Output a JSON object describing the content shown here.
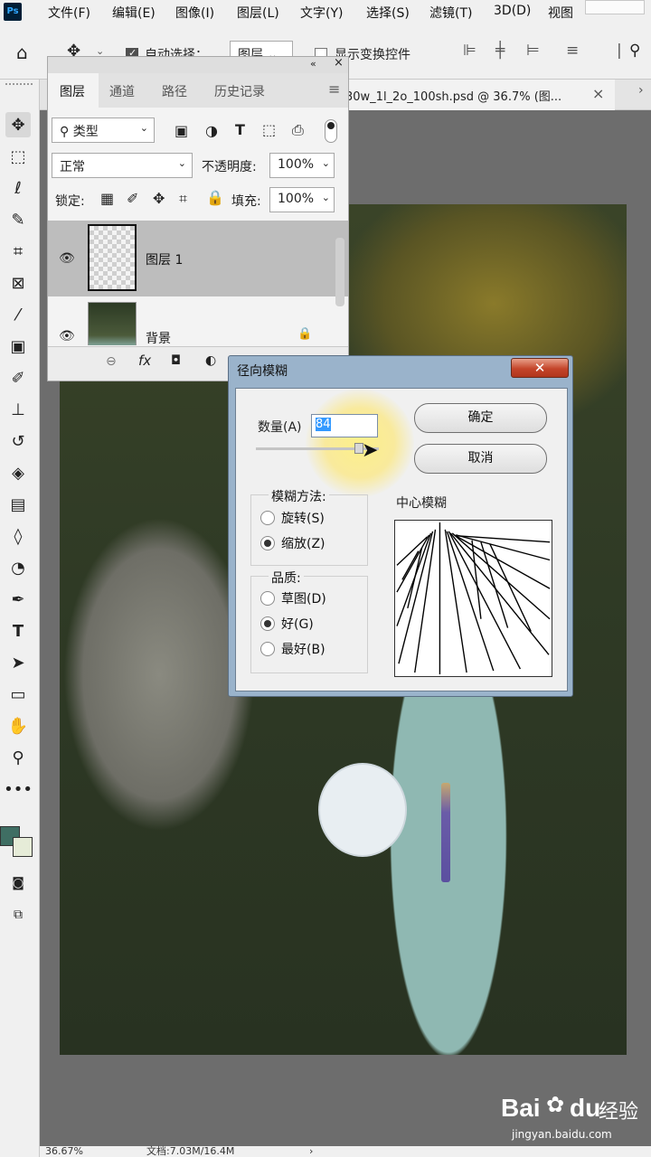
{
  "app": {
    "logo": "Ps"
  },
  "menu": [
    "文件(F)",
    "编辑(E)",
    "图像(I)",
    "图层(L)",
    "文字(Y)",
    "选择(S)",
    "滤镜(T)",
    "3D(D)",
    "视图"
  ],
  "options": {
    "auto_select_label": "自动选择：",
    "auto_select_checked": true,
    "auto_select_target": "图层",
    "show_transform_label": "显示变换控件",
    "show_transform_checked": false
  },
  "document": {
    "tab_title": "30w_1l_2o_100sh.psd @ 36.7% (图...",
    "zoom": "36.67%",
    "doc_size": "文档:7.03M/16.4M"
  },
  "layers_panel": {
    "tabs": [
      "图层",
      "通道",
      "路径",
      "历史记录"
    ],
    "active_tab": "图层",
    "filter_label": "类型",
    "blend_mode": "正常",
    "opacity_label": "不透明度:",
    "opacity": "100%",
    "lock_label": "锁定:",
    "fill_label": "填充:",
    "fill": "100%",
    "layers": [
      {
        "name": "图层 1",
        "visible": true,
        "selected": true
      },
      {
        "name": "背景",
        "visible": true,
        "selected": false,
        "locked": true
      }
    ]
  },
  "dialog": {
    "title": "径向模糊",
    "amount_label": "数量(A)",
    "amount_value": "84",
    "ok": "确定",
    "cancel": "取消",
    "method_label": "模糊方法:",
    "method_options": [
      "旋转(S)",
      "缩放(Z)"
    ],
    "method_selected": "缩放(Z)",
    "quality_label": "品质:",
    "quality_options": [
      "草图(D)",
      "好(G)",
      "最好(B)"
    ],
    "quality_selected": "好(G)",
    "center_label": "中心模糊"
  },
  "watermark": {
    "brand": "Bai",
    "brand2": "du",
    "cn": "经验",
    "url": "jingyan.baidu.com"
  },
  "colors": {
    "foreground": "#3f6e63",
    "background": "#e6ecd8",
    "accent": "#3399ff"
  }
}
